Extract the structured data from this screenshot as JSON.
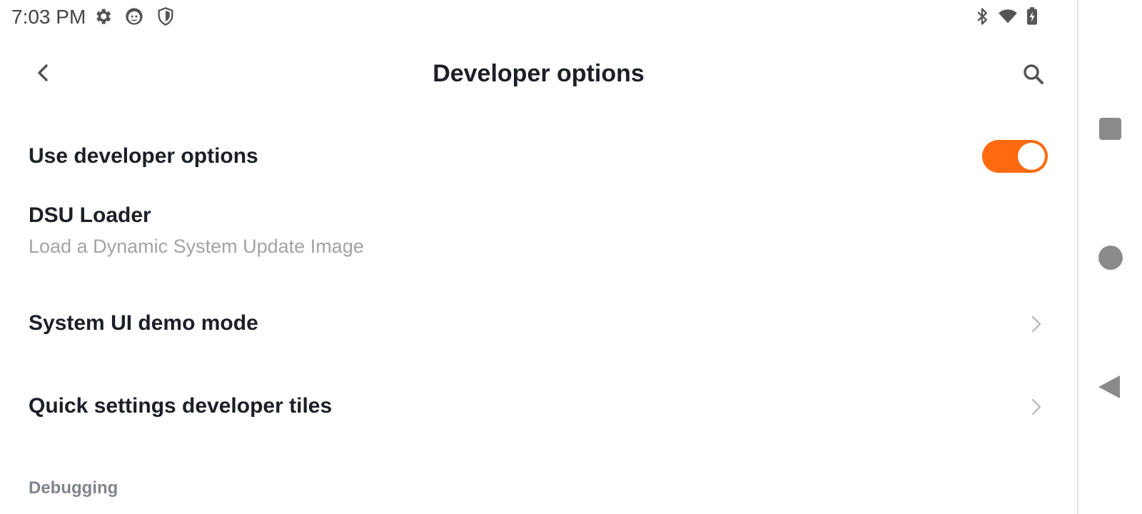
{
  "status_bar": {
    "time": "7:03 PM",
    "left_icons": [
      "gear-icon",
      "cat-face-icon",
      "shield-icon"
    ],
    "right_icons": [
      "bluetooth-icon",
      "wifi-icon",
      "battery-charging-icon"
    ]
  },
  "header": {
    "title": "Developer options",
    "back_icon": "chevron-left-icon",
    "search_icon": "search-icon"
  },
  "settings": {
    "use_developer_options": {
      "label": "Use developer options",
      "enabled": true
    },
    "dsu_loader": {
      "label": "DSU Loader",
      "summary": "Load a Dynamic System Update Image"
    },
    "system_ui_demo_mode": {
      "label": "System UI demo mode"
    },
    "quick_settings_tiles": {
      "label": "Quick settings developer tiles"
    },
    "section_debugging": "Debugging"
  },
  "navigation": {
    "buttons": [
      "recents-button",
      "home-button",
      "back-button"
    ]
  },
  "colors": {
    "accent": "#ff6a10",
    "text_primary": "#1c1f26",
    "text_secondary": "#a3a3a3",
    "section_header": "#80848c"
  }
}
